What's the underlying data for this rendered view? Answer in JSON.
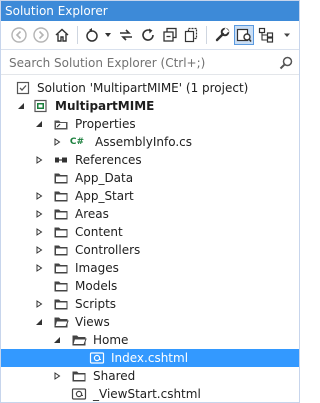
{
  "window": {
    "title": "Solution Explorer"
  },
  "toolbar": {
    "buttons": [
      {
        "icon": "back-icon"
      },
      {
        "icon": "forward-icon"
      },
      {
        "icon": "home-icon"
      },
      {
        "icon": "pending-changes-filter-icon"
      },
      {
        "icon": "sync-with-active-document-icon"
      },
      {
        "icon": "refresh-icon"
      },
      {
        "icon": "collapse-all-icon"
      },
      {
        "icon": "show-all-files-icon"
      },
      {
        "icon": "properties-icon"
      },
      {
        "icon": "preview-selected-items-icon"
      },
      {
        "icon": "class-view-icon"
      }
    ],
    "active_button": "preview-selected-items-icon"
  },
  "search": {
    "placeholder": "Search Solution Explorer (Ctrl+;)"
  },
  "tree": {
    "solution": "Solution 'MultipartMIME' (1 project)",
    "project": "MultipartMIME",
    "properties": "Properties",
    "assemblyinfo": "AssemblyInfo.cs",
    "references": "References",
    "app_data": "App_Data",
    "app_start": "App_Start",
    "areas": "Areas",
    "content": "Content",
    "controllers": "Controllers",
    "images": "Images",
    "models": "Models",
    "scripts": "Scripts",
    "views": "Views",
    "home": "Home",
    "index": "Index.cshtml",
    "shared": "Shared",
    "viewstart": "_ViewStart.cshtml"
  },
  "selected_item": "Index.cshtml",
  "colors": {
    "title_bar": "#3d8ad8",
    "selection": "#3399ff",
    "folder": "#444444",
    "csharp": "#1a7f3c"
  }
}
